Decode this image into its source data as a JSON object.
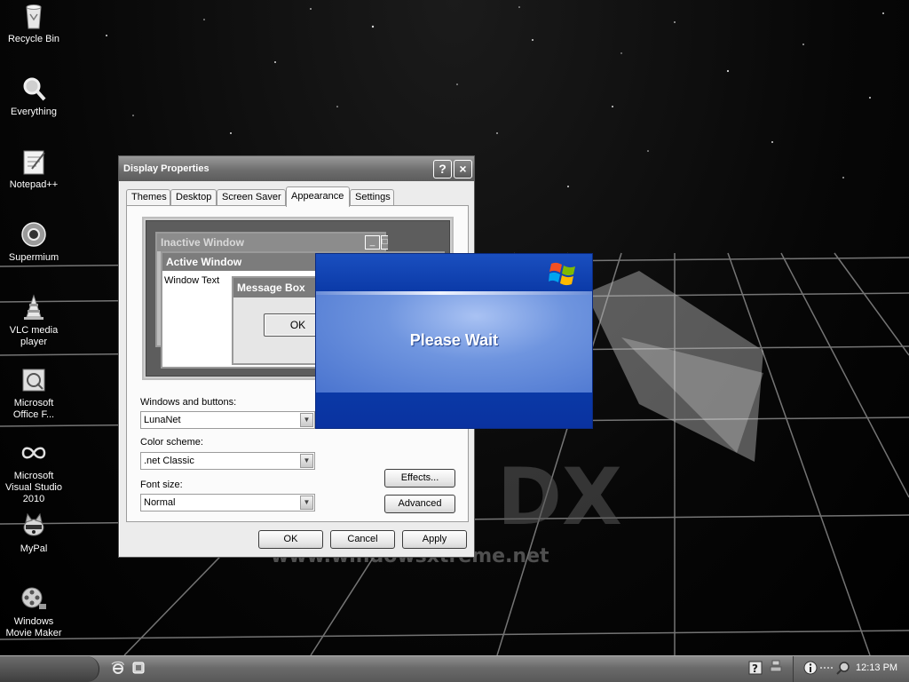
{
  "desktop": {
    "icons": [
      {
        "label": "Recycle Bin",
        "icon": "recycle-bin-icon"
      },
      {
        "label": "Everything",
        "icon": "magnifier-icon"
      },
      {
        "label": "Notepad++",
        "icon": "notepad-plus-plus-icon"
      },
      {
        "label": "Supermium",
        "icon": "supermium-browser-icon"
      },
      {
        "label": "VLC media player",
        "icon": "vlc-cone-icon"
      },
      {
        "label": "Microsoft Office F...",
        "icon": "office-document-icon"
      },
      {
        "label": "Microsoft Visual Studio 2010",
        "icon": "visual-studio-infinity-icon"
      },
      {
        "label": "MyPal",
        "icon": "raccoon-icon"
      },
      {
        "label": "Windows Movie Maker",
        "icon": "film-reel-icon"
      }
    ],
    "wallpaper_text": "www.windowsxtreme.net",
    "wallpaper_logo_letters": "DX"
  },
  "display_properties": {
    "title": "Display Properties",
    "tabs": [
      "Themes",
      "Desktop",
      "Screen Saver",
      "Appearance",
      "Settings"
    ],
    "active_tab": "Appearance",
    "preview": {
      "inactive_window": "Inactive Window",
      "active_window": "Active Window",
      "window_text": "Window Text",
      "message_box": "Message Box",
      "ok": "OK"
    },
    "windows_and_buttons_label": "Windows and buttons:",
    "windows_and_buttons_value": "LunaNet",
    "color_scheme_label": "Color scheme:",
    "color_scheme_value": ".net Classic",
    "font_size_label": "Font size:",
    "font_size_value": "Normal",
    "effects_button": "Effects...",
    "advanced_button": "Advanced",
    "ok_button": "OK",
    "cancel_button": "Cancel",
    "apply_button": "Apply"
  },
  "please_wait": {
    "text": "Please Wait"
  },
  "taskbar": {
    "clock": "12:13 PM",
    "colors": {
      "bar": "#6a6a6a",
      "wait_blue": "#0b3aa0"
    }
  }
}
